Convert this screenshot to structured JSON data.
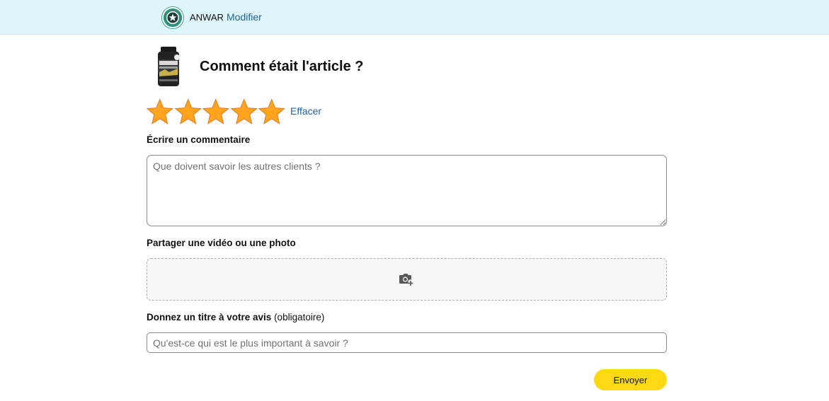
{
  "header": {
    "username": "ANWAR",
    "modify_label": "Modifier",
    "avatar_icon": "star-badge-avatar-icon",
    "background_color": "#def5fb"
  },
  "product": {
    "title": "Comment était l'article ?",
    "thumbnail_icon": "supplement-bottle-icon",
    "thumbnail_text": "CREATINE"
  },
  "rating": {
    "value": 5,
    "max": 5,
    "star_color": "#ffa41c",
    "clear_label": "Effacer"
  },
  "comment": {
    "label": "Écrire un commentaire",
    "placeholder": "Que doivent savoir les autres clients ?",
    "value": ""
  },
  "media": {
    "label": "Partager une vidéo ou une photo",
    "upload_icon": "camera-add-icon"
  },
  "review_title": {
    "label": "Donnez un titre à votre avis",
    "required_note": "(obligatoire)",
    "placeholder": "Qu'est-ce qui est le plus important à savoir ?",
    "value": ""
  },
  "submit": {
    "label": "Envoyer",
    "color": "#ffd814"
  }
}
